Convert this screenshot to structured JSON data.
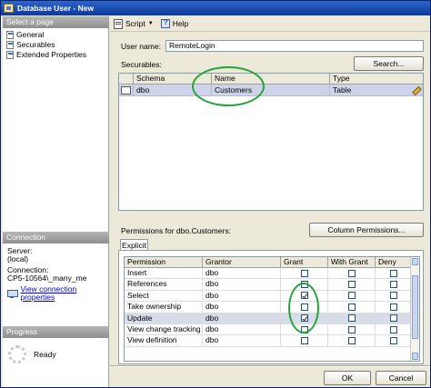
{
  "window": {
    "title": "Database User - New"
  },
  "left_pane": {
    "select_page_header": "Select a page",
    "pages": [
      {
        "label": "General",
        "icon": "page-icon"
      },
      {
        "label": "Securables",
        "icon": "page-icon"
      },
      {
        "label": "Extended Properties",
        "icon": "page-icon"
      }
    ],
    "connection_header": "Connection",
    "server_label": "Server:",
    "server_value": "(local)",
    "connection_label": "Connection:",
    "connection_value": "CP5-10564\\_many_me",
    "view_connection_link": "View connection properties",
    "progress_header": "Progress",
    "progress_status": "Ready"
  },
  "toolbar": {
    "script_label": "Script",
    "help_label": "Help"
  },
  "main": {
    "user_name_label": "User name:",
    "user_name_value": "RemoteLogin",
    "securables_label": "Securables:",
    "search_button": "Search...",
    "securables_columns": [
      "Schema",
      "Name",
      "Type"
    ],
    "securables_rows": [
      {
        "schema": "dbo",
        "name": "Customers",
        "type": "Table"
      }
    ],
    "permissions_label": "Permissions for dbo.Customers:",
    "column_permissions_button": "Column Permissions...",
    "tab_explicit": "Explicit",
    "permission_columns": [
      "Permission",
      "Grantor",
      "Grant",
      "With Grant",
      "Deny"
    ],
    "permission_rows": [
      {
        "permission": "Insert",
        "grantor": "dbo",
        "grant": false,
        "with_grant": false,
        "deny": false
      },
      {
        "permission": "References",
        "grantor": "dbo",
        "grant": false,
        "with_grant": false,
        "deny": false
      },
      {
        "permission": "Select",
        "grantor": "dbo",
        "grant": true,
        "with_grant": false,
        "deny": false
      },
      {
        "permission": "Take ownership",
        "grantor": "dbo",
        "grant": false,
        "with_grant": false,
        "deny": false
      },
      {
        "permission": "Update",
        "grantor": "dbo",
        "grant": true,
        "with_grant": false,
        "deny": false
      },
      {
        "permission": "View change tracking",
        "grantor": "dbo",
        "grant": false,
        "with_grant": false,
        "deny": false
      },
      {
        "permission": "View definition",
        "grantor": "dbo",
        "grant": false,
        "with_grant": false,
        "deny": false
      }
    ]
  },
  "buttons": {
    "ok": "OK",
    "cancel": "Cancel"
  },
  "colors": {
    "title_bar": "#0a3a9e",
    "selected_row": "#cfd3ea",
    "annotation": "#23a33a",
    "link": "#0000ee"
  }
}
